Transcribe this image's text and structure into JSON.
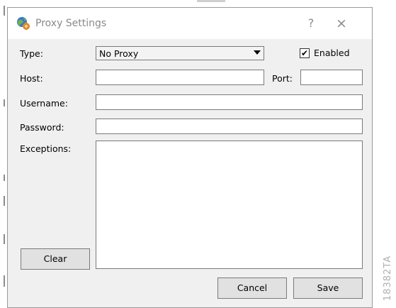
{
  "window": {
    "title": "Proxy Settings",
    "help_glyph": "?",
    "close_glyph": "×"
  },
  "form": {
    "type_label": "Type:",
    "type_value": "No Proxy",
    "enabled_label": "Enabled",
    "enabled_checked": true,
    "check_glyph": "✔",
    "host_label": "Host:",
    "host_value": "",
    "port_label": "Port:",
    "port_value": "",
    "username_label": "Username:",
    "username_value": "",
    "password_label": "Password:",
    "password_value": "",
    "exceptions_label": "Exceptions:",
    "exceptions_value": ""
  },
  "buttons": {
    "clear": "Clear",
    "cancel": "Cancel",
    "save": "Save"
  },
  "watermark": "18382TA",
  "icons": {
    "app": "globe-gear-icon",
    "dropdown": "chevron-down-icon",
    "help": "help-icon",
    "close": "close-icon"
  }
}
